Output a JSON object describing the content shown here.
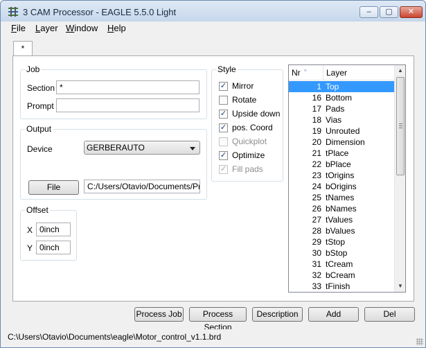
{
  "window": {
    "title": "3 CAM Processor - EAGLE 5.5.0 Light",
    "minimize_glyph": "–",
    "maximize_glyph": "▢",
    "close_glyph": "✕"
  },
  "menu": [
    "File",
    "Layer",
    "Window",
    "Help"
  ],
  "tabs": [
    {
      "label": "*"
    }
  ],
  "job": {
    "legend": "Job",
    "section_label": "Section",
    "section_value": "*",
    "prompt_label": "Prompt",
    "prompt_value": ""
  },
  "output": {
    "legend": "Output",
    "device_label": "Device",
    "device_value": "GERBERAUTO",
    "file_button": "File",
    "file_path": "C:/Users/Otavio/Documents/Proce"
  },
  "offset": {
    "legend": "Offset",
    "x_label": "X",
    "x_value": "0inch",
    "y_label": "Y",
    "y_value": "0inch"
  },
  "style": {
    "legend": "Style",
    "options": [
      {
        "label": "Mirror",
        "checked": true,
        "enabled": true
      },
      {
        "label": "Rotate",
        "checked": false,
        "enabled": true
      },
      {
        "label": "Upside down",
        "checked": true,
        "enabled": true
      },
      {
        "label": "pos. Coord",
        "checked": true,
        "enabled": true
      },
      {
        "label": "Quickplot",
        "checked": false,
        "enabled": false
      },
      {
        "label": "Optimize",
        "checked": true,
        "enabled": true
      },
      {
        "label": "Fill pads",
        "checked": true,
        "enabled": false
      }
    ]
  },
  "layers": {
    "columns": [
      "Nr",
      "Layer"
    ],
    "sort_glyph": "^",
    "rows": [
      {
        "nr": "1",
        "name": "Top",
        "selected": true
      },
      {
        "nr": "16",
        "name": "Bottom",
        "selected": false
      },
      {
        "nr": "17",
        "name": "Pads",
        "selected": false
      },
      {
        "nr": "18",
        "name": "Vias",
        "selected": false
      },
      {
        "nr": "19",
        "name": "Unrouted",
        "selected": false
      },
      {
        "nr": "20",
        "name": "Dimension",
        "selected": false
      },
      {
        "nr": "21",
        "name": "tPlace",
        "selected": false
      },
      {
        "nr": "22",
        "name": "bPlace",
        "selected": false
      },
      {
        "nr": "23",
        "name": "tOrigins",
        "selected": false
      },
      {
        "nr": "24",
        "name": "bOrigins",
        "selected": false
      },
      {
        "nr": "25",
        "name": "tNames",
        "selected": false
      },
      {
        "nr": "26",
        "name": "bNames",
        "selected": false
      },
      {
        "nr": "27",
        "name": "tValues",
        "selected": false
      },
      {
        "nr": "28",
        "name": "bValues",
        "selected": false
      },
      {
        "nr": "29",
        "name": "tStop",
        "selected": false
      },
      {
        "nr": "30",
        "name": "bStop",
        "selected": false
      },
      {
        "nr": "31",
        "name": "tCream",
        "selected": false
      },
      {
        "nr": "32",
        "name": "bCream",
        "selected": false
      },
      {
        "nr": "33",
        "name": "tFinish",
        "selected": false
      }
    ]
  },
  "buttons": {
    "process_job": "Process Job",
    "process_section": "Process Section",
    "description": "Description",
    "add": "Add",
    "del": "Del"
  },
  "status": {
    "path": "C:\\Users\\Otavio\\Documents\\eagle\\Motor_control_v1.1.brd"
  },
  "colors": {
    "selection": "#3399ff",
    "check": "#1c3f8a"
  }
}
